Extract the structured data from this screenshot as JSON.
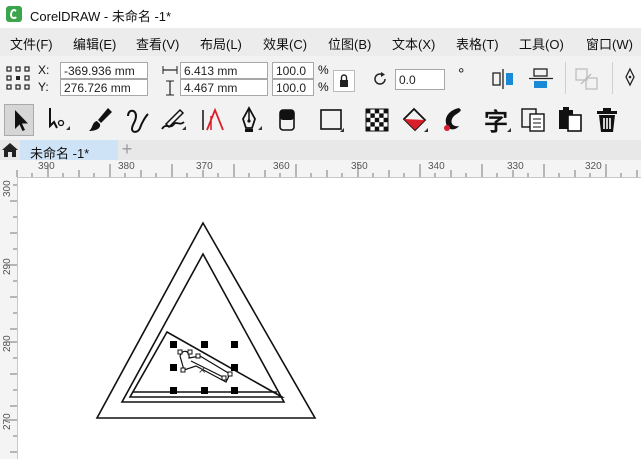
{
  "window": {
    "title": "CorelDRAW - 未命名 -1*"
  },
  "menu": [
    {
      "id": "file",
      "label": "文件(F)"
    },
    {
      "id": "edit",
      "label": "编辑(E)"
    },
    {
      "id": "view",
      "label": "查看(V)"
    },
    {
      "id": "layout",
      "label": "布局(L)"
    },
    {
      "id": "effects",
      "label": "效果(C)"
    },
    {
      "id": "bitmaps",
      "label": "位图(B)"
    },
    {
      "id": "text",
      "label": "文本(X)"
    },
    {
      "id": "table",
      "label": "表格(T)"
    },
    {
      "id": "tools",
      "label": "工具(O)"
    },
    {
      "id": "window",
      "label": "窗口(W)"
    }
  ],
  "properties": {
    "x_label": "X:",
    "x_value": "-369.936 mm",
    "y_label": "Y:",
    "y_value": "276.726 mm",
    "width_value": "6.413 mm",
    "height_value": "4.467 mm",
    "scale_w": "100.0",
    "scale_h": "100.0",
    "percent": "%",
    "rotation_value": "0.0",
    "degree": "°"
  },
  "tabs": {
    "document_label": "未命名 -1*",
    "add_label": "+"
  },
  "ruler": {
    "h_ticks": [
      "390",
      "380",
      "370",
      "360",
      "350",
      "340",
      "330",
      "320"
    ],
    "v_ticks": [
      "300",
      "290",
      "280",
      "270"
    ]
  },
  "colors": {
    "menu_bg": "#ececec",
    "toolbar_bg": "#f2f2f2",
    "tab_active": "#cfe3f7",
    "accent_blue": "#1b8ad6",
    "accent_red": "#d9202a",
    "logo_green": "#3aa54a"
  }
}
